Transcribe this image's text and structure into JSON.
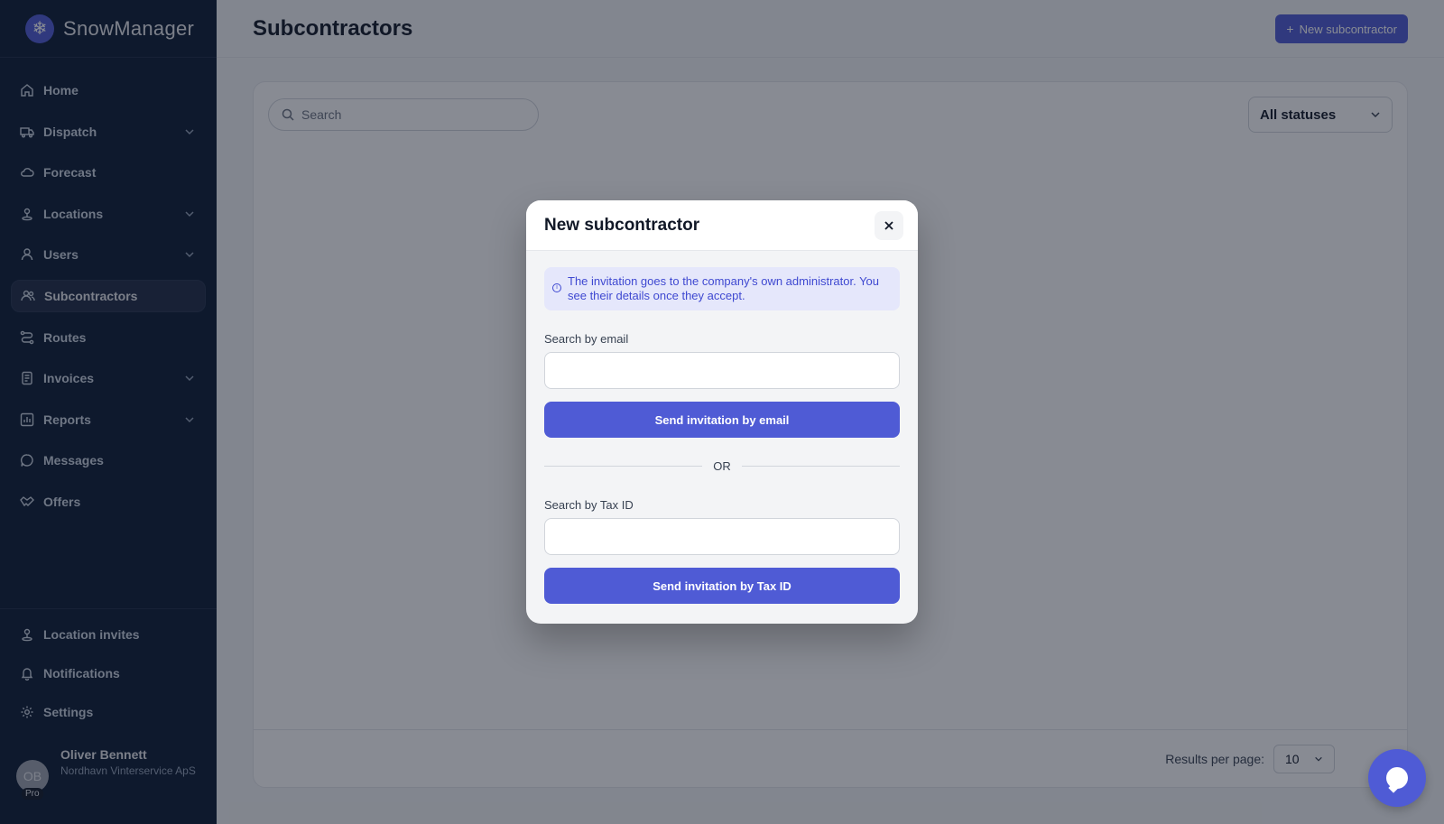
{
  "app": {
    "name": "SnowManager"
  },
  "sidebar": {
    "items": [
      {
        "label": "Home",
        "icon": "home-icon",
        "expandable": false,
        "active": false
      },
      {
        "label": "Dispatch",
        "icon": "truck-icon",
        "expandable": true,
        "active": false
      },
      {
        "label": "Forecast",
        "icon": "cloud-icon",
        "expandable": false,
        "active": false
      },
      {
        "label": "Locations",
        "icon": "location-pin-icon",
        "expandable": true,
        "active": false
      },
      {
        "label": "Users",
        "icon": "user-icon",
        "expandable": true,
        "active": false
      },
      {
        "label": "Subcontractors",
        "icon": "users-icon",
        "expandable": false,
        "active": true
      },
      {
        "label": "Routes",
        "icon": "route-icon",
        "expandable": false,
        "active": false
      },
      {
        "label": "Invoices",
        "icon": "document-icon",
        "expandable": true,
        "active": false
      },
      {
        "label": "Reports",
        "icon": "bar-chart-icon",
        "expandable": true,
        "active": false
      },
      {
        "label": "Messages",
        "icon": "chat-icon",
        "expandable": false,
        "active": false
      },
      {
        "label": "Offers",
        "icon": "handshake-icon",
        "expandable": false,
        "active": false
      }
    ],
    "bottom_items": [
      {
        "label": "Location invites",
        "icon": "location-pin-icon"
      },
      {
        "label": "Notifications",
        "icon": "bell-icon"
      },
      {
        "label": "Settings",
        "icon": "gear-icon"
      }
    ],
    "profile": {
      "initials": "OB",
      "badge": "Pro",
      "name": "Oliver Bennett",
      "company": "Nordhavn Vinterservice ApS"
    }
  },
  "header": {
    "title": "Subcontractors",
    "new_button_label": "New subcontractor"
  },
  "filters": {
    "search_placeholder": "Search",
    "status_value": "All statuses"
  },
  "footer": {
    "results_per_page_label": "Results per page:",
    "results_per_page_value": "10"
  },
  "modal": {
    "title": "New subcontractor",
    "info_text": "The invitation goes to the company's own administrator. You see their details once they accept.",
    "email_label": "Search by email",
    "email_value": "",
    "email_button": "Send invitation by email",
    "divider_text": "OR",
    "tax_label": "Search by Tax ID",
    "tax_value": "",
    "tax_button": "Send invitation by Tax ID"
  },
  "colors": {
    "accent": "#4f5bd5",
    "sidebar_bg": "#0b1a33"
  }
}
